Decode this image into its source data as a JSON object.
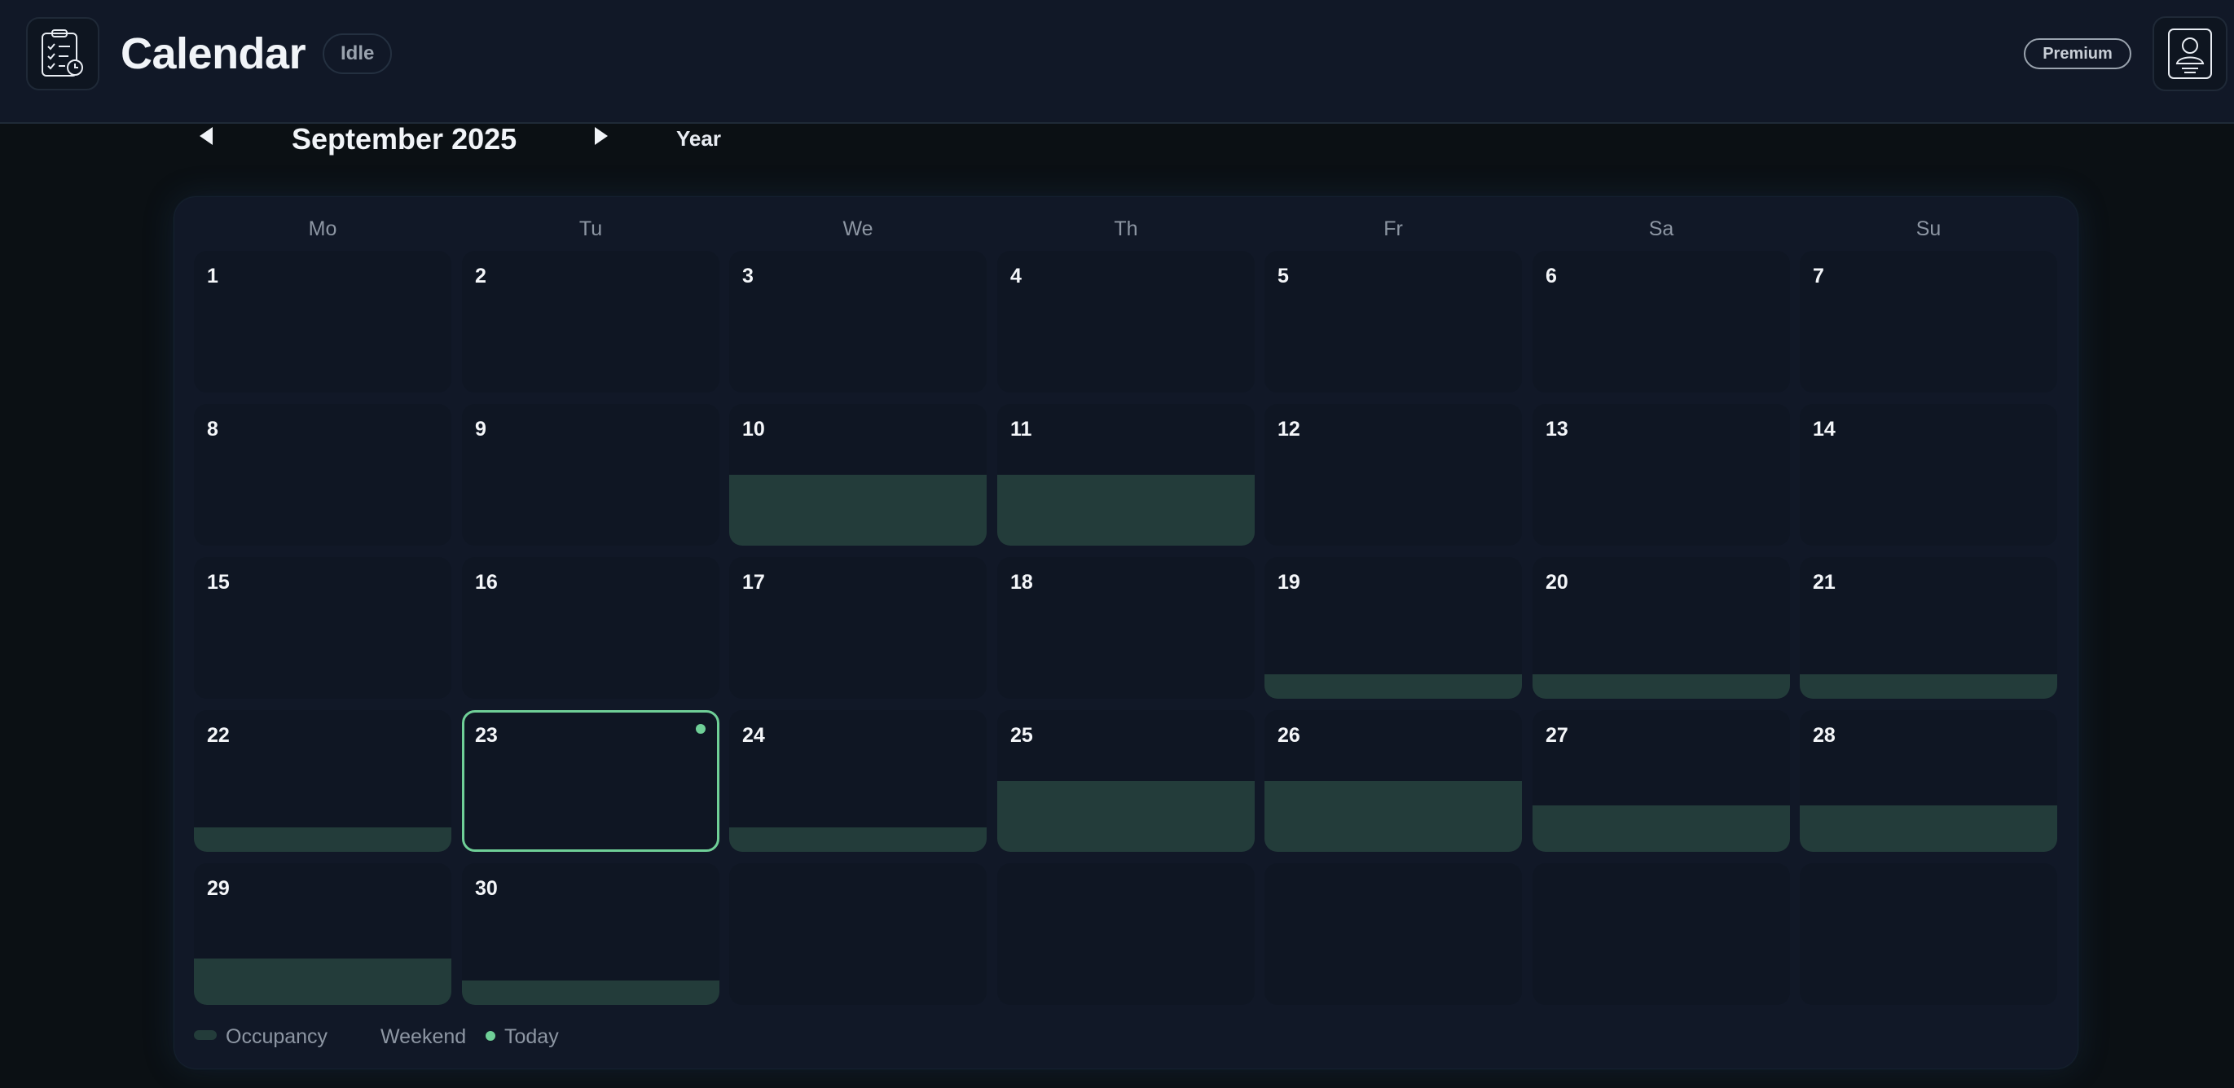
{
  "header": {
    "title": "Calendar",
    "status": "Idle",
    "plan_badge": "Premium",
    "app_icon": "clipboard-checklist-icon",
    "avatar_icon": "user-icon"
  },
  "nav": {
    "month_label": "September 2025",
    "view_button": "Year"
  },
  "calendar": {
    "weekdays": [
      "Mo",
      "Tu",
      "We",
      "Th",
      "Fr",
      "Sa",
      "Su"
    ],
    "days": [
      {
        "label": "1",
        "occupancy": 0
      },
      {
        "label": "2",
        "occupancy": 0
      },
      {
        "label": "3",
        "occupancy": 0
      },
      {
        "label": "4",
        "occupancy": 0
      },
      {
        "label": "5",
        "occupancy": 0
      },
      {
        "label": "6",
        "occupancy": 0
      },
      {
        "label": "7",
        "occupancy": 0
      },
      {
        "label": "8",
        "occupancy": 0
      },
      {
        "label": "9",
        "occupancy": 0
      },
      {
        "label": "10",
        "occupancy": 0.5
      },
      {
        "label": "11",
        "occupancy": 0.5
      },
      {
        "label": "12",
        "occupancy": 0
      },
      {
        "label": "13",
        "occupancy": 0
      },
      {
        "label": "14",
        "occupancy": 0
      },
      {
        "label": "15",
        "occupancy": 0
      },
      {
        "label": "16",
        "occupancy": 0
      },
      {
        "label": "17",
        "occupancy": 0
      },
      {
        "label": "18",
        "occupancy": 0
      },
      {
        "label": "19",
        "occupancy": 0.17
      },
      {
        "label": "20",
        "occupancy": 0.17
      },
      {
        "label": "21",
        "occupancy": 0.17
      },
      {
        "label": "22",
        "occupancy": 0.17
      },
      {
        "label": "23",
        "occupancy": 0,
        "today": true
      },
      {
        "label": "24",
        "occupancy": 0.17
      },
      {
        "label": "25",
        "occupancy": 0.5
      },
      {
        "label": "26",
        "occupancy": 0.5
      },
      {
        "label": "27",
        "occupancy": 0.33
      },
      {
        "label": "28",
        "occupancy": 0.33
      },
      {
        "label": "29",
        "occupancy": 0.33
      },
      {
        "label": "30",
        "occupancy": 0.17
      }
    ],
    "leading_blanks": 0,
    "trailing_blanks": 5
  },
  "legend": {
    "occupancy": "Occupancy",
    "weekend": "Weekend",
    "today": "Today"
  },
  "colors": {
    "background": "#0b1014",
    "panel": "#111827",
    "cell": "#0f1623",
    "occupancy": "#233c3a",
    "today_accent": "#6fcf97"
  }
}
